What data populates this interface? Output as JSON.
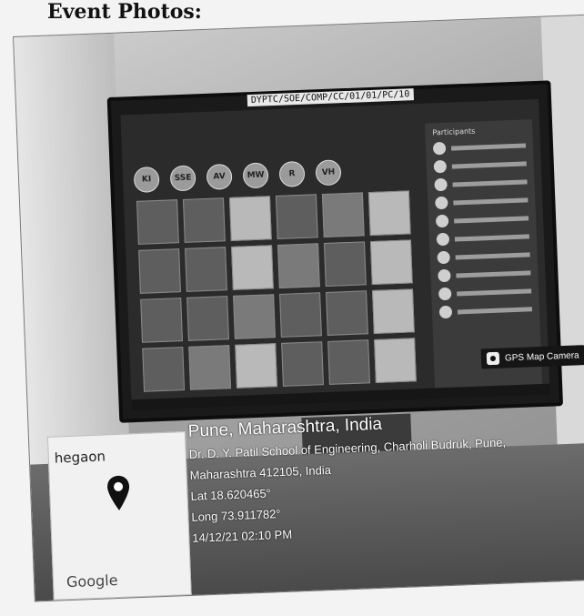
{
  "heading": "Event Photos:",
  "photo": {
    "monitor_label": "DYPTC/SOE/COMP/CC/01/01/PC/10",
    "participants_title": "Participants",
    "avatars": [
      "KI",
      "SSE",
      "AV",
      "MW",
      "R",
      "VH"
    ],
    "geotag": {
      "place": "Pune, Maharashtra, India",
      "address_line1": "Dr. D. Y. Patil School of Engineering, Charholi Budruk, Pune,",
      "address_line2": "Maharashtra 412105, India",
      "latitude": "Lat 18.620465°",
      "longitude": "Long 73.911782°",
      "datetime": "14/12/21 02:10 PM"
    },
    "map": {
      "place_label": "hegaon",
      "brand": "Google"
    },
    "camera_app": "GPS Map Camera",
    "icons": [
      "map-pin-icon",
      "camera-icon"
    ]
  }
}
